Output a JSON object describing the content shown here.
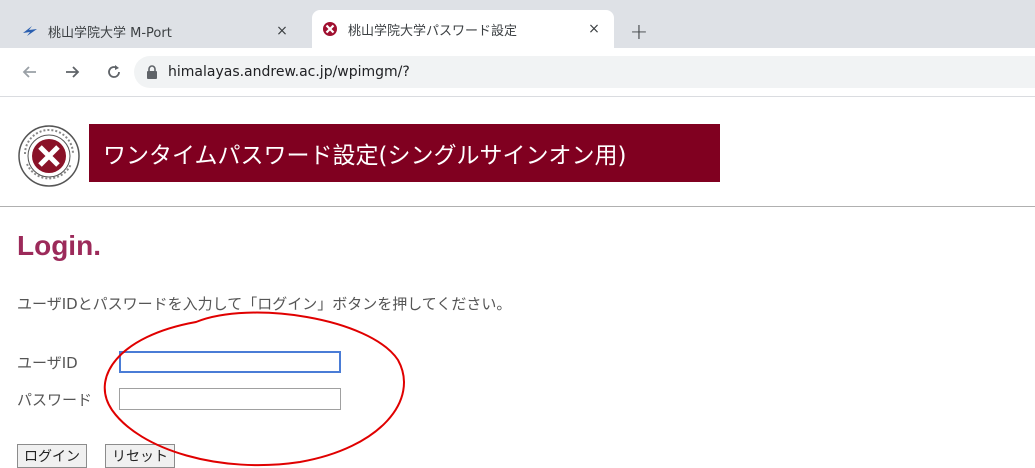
{
  "browser": {
    "tabs": [
      {
        "title": "桃山学院大学 M-Port",
        "close": "×",
        "favicon": "m-port-logo-icon"
      },
      {
        "title": "桃山学院大学パスワード設定",
        "close": "×",
        "favicon": "university-crest-icon"
      }
    ],
    "new_tab": "+",
    "back_icon": "arrow-left-icon",
    "forward_icon": "arrow-right-icon",
    "reload_icon": "reload-icon",
    "url": "himalayas.andrew.ac.jp/wpimgm/?"
  },
  "header": {
    "banner_title": "ワンタイムパスワード設定(シングルサインオン用)",
    "banner_color": "#800020",
    "logo_text_top": "St.Andrew's University",
    "logo_text_bottom": "ESTABLISHED 1959"
  },
  "login": {
    "heading": "Login.",
    "heading_color": "#9c2a5a",
    "instructions": "ユーザIDとパスワードを入力して「ログイン」ボタンを押してください。",
    "userid_label": "ユーザID",
    "userid_value": "",
    "password_label": "パスワード",
    "password_value": "",
    "login_button": "ログイン",
    "reset_button": "リセット"
  },
  "annotation": {
    "shape": "ellipse",
    "color": "#e00000"
  }
}
